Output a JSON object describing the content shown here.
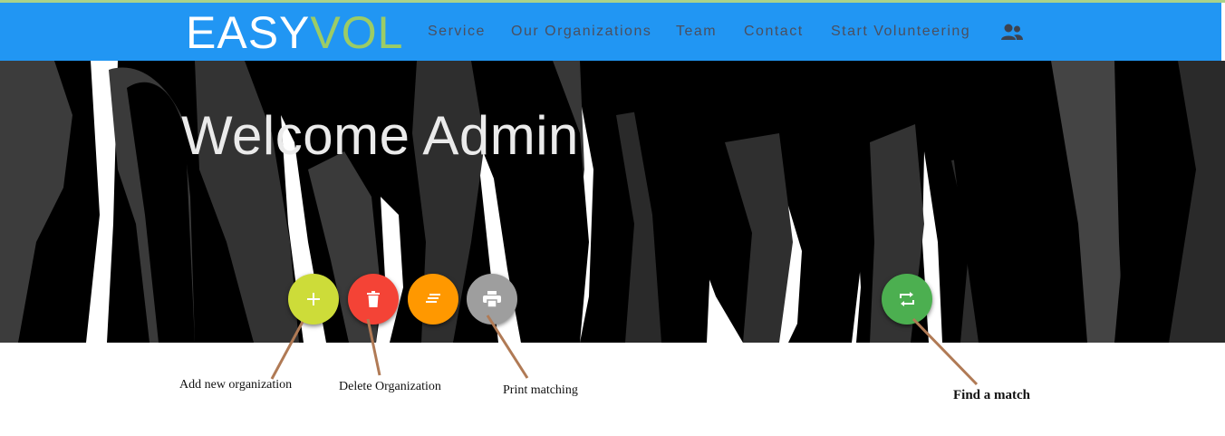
{
  "brand": {
    "part1": "EASY",
    "part2": "VOL"
  },
  "nav": {
    "items": [
      {
        "label": "Service"
      },
      {
        "label": "Our Organizations"
      },
      {
        "label": "Team"
      },
      {
        "label": "Contact"
      },
      {
        "label": "Start Volunteering"
      }
    ],
    "account_icon": "people-icon"
  },
  "hero": {
    "title": "Welcome Admin"
  },
  "actions": [
    {
      "icon": "plus-icon",
      "color": "#cddc39",
      "caption": "Add new organization"
    },
    {
      "icon": "trash-icon",
      "color": "#f44336",
      "caption": "Delete Organization"
    },
    {
      "icon": "list-icon",
      "color": "#ff9800",
      "caption": ""
    },
    {
      "icon": "print-icon",
      "color": "#9e9e9e",
      "caption": "Print matching"
    },
    {
      "icon": "swap-icon",
      "color": "#4caf50",
      "caption": "Find a match"
    }
  ],
  "colors": {
    "navbar": "#2196f3",
    "accent_green": "#9ccc65",
    "arrow": "#b07a55"
  }
}
